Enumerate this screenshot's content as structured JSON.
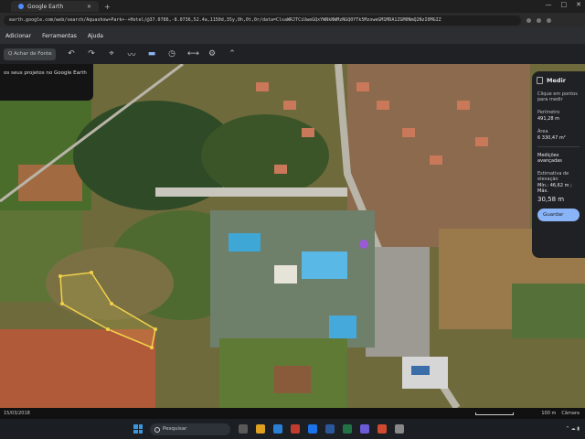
{
  "browser": {
    "tab_title": "Google Earth",
    "url": "earth.google.com/web/search/Aquashow+Park+-+Hotel/@37.0786,-8.0736,52.4a,1150d,35y,0h,0t,0r/data=ClsaWRJTCiUweGQxYWNkNWMzNGQ0YTk5MzoweGM1MDA1ZGM0NmQ2NzI0MGIZ",
    "window_controls": [
      "—",
      "□",
      "✕"
    ]
  },
  "menu": {
    "items": [
      "Adicionar",
      "Ferramentas",
      "Ajuda"
    ]
  },
  "toolbar": {
    "search_placeholder": "Q  Achar de Fonte"
  },
  "project_banner": {
    "text": "os seus projetos no Google Earth"
  },
  "measure_panel": {
    "title": "Medir",
    "instruction": "Clique em pontos para medir",
    "perimeter_label": "Perímetro",
    "perimeter_value": "491,28 m",
    "area_label": "Área",
    "area_value": "6 330,47 m²",
    "advanced_label": "Medições avançadas",
    "estimate_label": "Estimativa de elevação",
    "elevation_range": "Mín.: 46,62 m ; Máx.",
    "elevation_value": "30,58 m",
    "save_label": "Guardar"
  },
  "status_bar": {
    "date": "15/03/2018",
    "scale_label": "100 m",
    "camera": "Câmara"
  },
  "taskbar": {
    "search_placeholder": "Pesquisar"
  }
}
